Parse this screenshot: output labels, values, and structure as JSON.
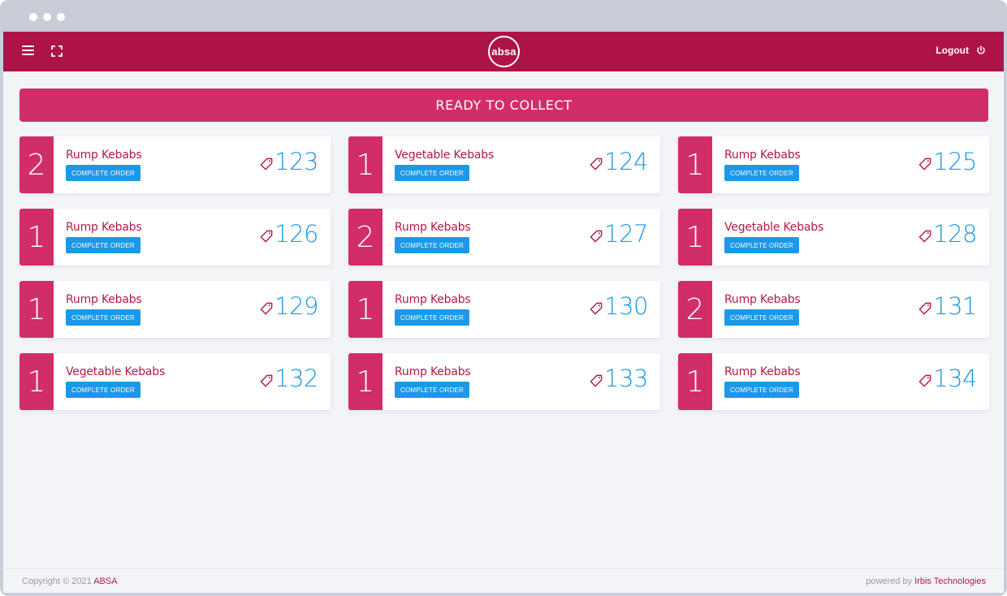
{
  "header": {
    "logo_text": "absa",
    "logout_label": "Logout"
  },
  "banner": {
    "title": "READY TO COLLECT"
  },
  "orders": [
    {
      "qty": "2",
      "item": "Rump Kebabs",
      "number": "123",
      "button": "COMPLETE ORDER"
    },
    {
      "qty": "1",
      "item": "Vegetable Kebabs",
      "number": "124",
      "button": "COMPLETE ORDER"
    },
    {
      "qty": "1",
      "item": "Rump Kebabs",
      "number": "125",
      "button": "COMPLETE ORDER"
    },
    {
      "qty": "1",
      "item": "Rump Kebabs",
      "number": "126",
      "button": "COMPLETE ORDER"
    },
    {
      "qty": "2",
      "item": "Rump Kebabs",
      "number": "127",
      "button": "COMPLETE ORDER"
    },
    {
      "qty": "1",
      "item": "Vegetable Kebabs",
      "number": "128",
      "button": "COMPLETE ORDER"
    },
    {
      "qty": "1",
      "item": "Rump Kebabs",
      "number": "129",
      "button": "COMPLETE ORDER"
    },
    {
      "qty": "1",
      "item": "Rump Kebabs",
      "number": "130",
      "button": "COMPLETE ORDER"
    },
    {
      "qty": "2",
      "item": "Rump Kebabs",
      "number": "131",
      "button": "COMPLETE ORDER"
    },
    {
      "qty": "1",
      "item": "Vegetable Kebabs",
      "number": "132",
      "button": "COMPLETE ORDER"
    },
    {
      "qty": "1",
      "item": "Rump Kebabs",
      "number": "133",
      "button": "COMPLETE ORDER"
    },
    {
      "qty": "1",
      "item": "Rump Kebabs",
      "number": "134",
      "button": "COMPLETE ORDER"
    }
  ],
  "footer": {
    "copyright": "Copyright © 2021",
    "brand": "ABSA",
    "powered_by": "powered by",
    "vendor": "Irbis Technologies"
  },
  "colors": {
    "header_bg": "#ae1347",
    "accent": "#d12d68",
    "button_blue": "#1d98e8"
  },
  "icons": {
    "menu": "hamburger-icon",
    "fullscreen": "fullscreen-icon",
    "logout": "power-icon",
    "order_tag": "tag-icon"
  }
}
